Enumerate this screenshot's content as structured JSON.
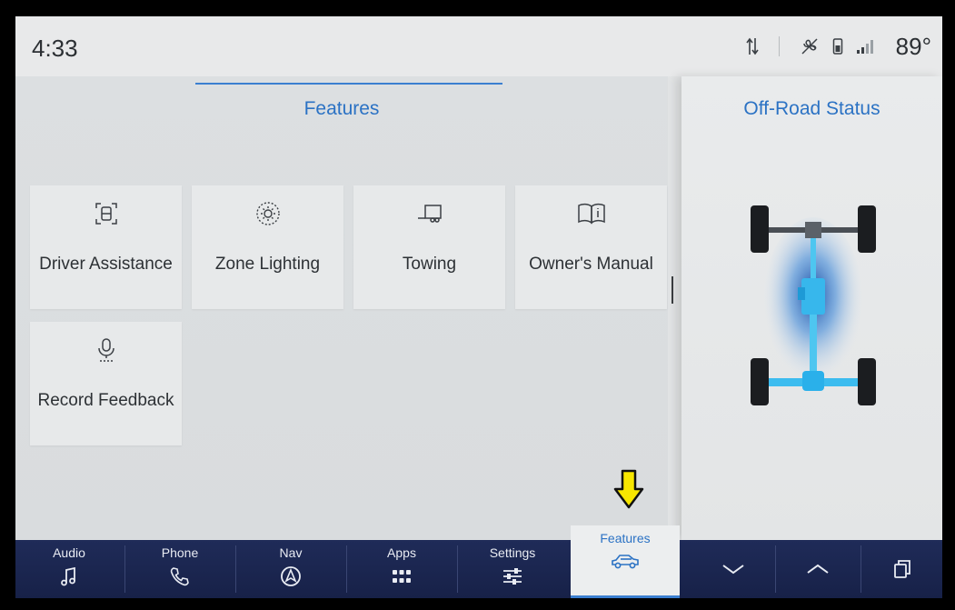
{
  "status": {
    "time": "4:33",
    "temperature": "89°"
  },
  "features": {
    "title": "Features",
    "tiles": [
      {
        "label": "Driver Assistance",
        "icon": "driver-assist-icon"
      },
      {
        "label": "Zone Lighting",
        "icon": "zone-lighting-icon"
      },
      {
        "label": "Towing",
        "icon": "towing-icon"
      },
      {
        "label": "Owner's Manual",
        "icon": "owners-manual-icon"
      },
      {
        "label": "Record Feedback",
        "icon": "microphone-icon"
      }
    ]
  },
  "offroad": {
    "title": "Off-Road Status"
  },
  "nav": {
    "items": [
      {
        "label": "Audio",
        "icon": "music-note-icon"
      },
      {
        "label": "Phone",
        "icon": "phone-icon"
      },
      {
        "label": "Nav",
        "icon": "navigation-icon"
      },
      {
        "label": "Apps",
        "icon": "apps-grid-icon"
      },
      {
        "label": "Settings",
        "icon": "sliders-icon"
      },
      {
        "label": "Features",
        "icon": "vehicle-icon"
      }
    ],
    "active": "Features"
  },
  "colors": {
    "accent": "#2b72c4",
    "nav_bg": "#1f2b58",
    "annotation": "#f7e600"
  }
}
